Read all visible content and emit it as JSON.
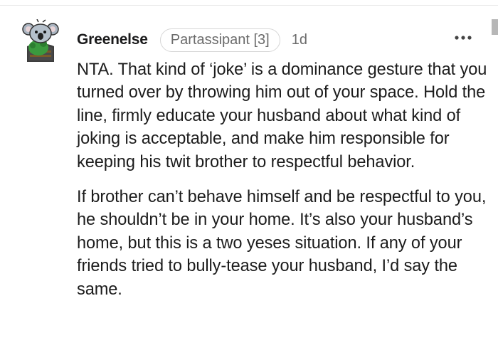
{
  "comment": {
    "author": "Greenelse",
    "flair": "Partassipant [3]",
    "time": "1d",
    "more_icon": "more-horizontal-icon",
    "paragraphs": [
      "NTA. That kind of ‘joke’ is a dominance gesture that you turned over by throwing him out of your space. Hold the line, firmly educate your husband about what kind of joking is acceptable, and make him responsible for keeping his twit brother to respectful behavior.",
      "If brother can’t behave himself and be respectful to you, he shouldn’t be in your home. It’s also your husband’s home, but this is a two yeses situation. If any of your friends tried to bully-tease your husband, I’d say the same."
    ]
  },
  "colors": {
    "text": "#1c1c1c",
    "meta": "#6b6b6b",
    "flair_border": "#d6d6d6",
    "avatar_green": "#3a9a3e",
    "avatar_koala": "#a9b4c0"
  }
}
